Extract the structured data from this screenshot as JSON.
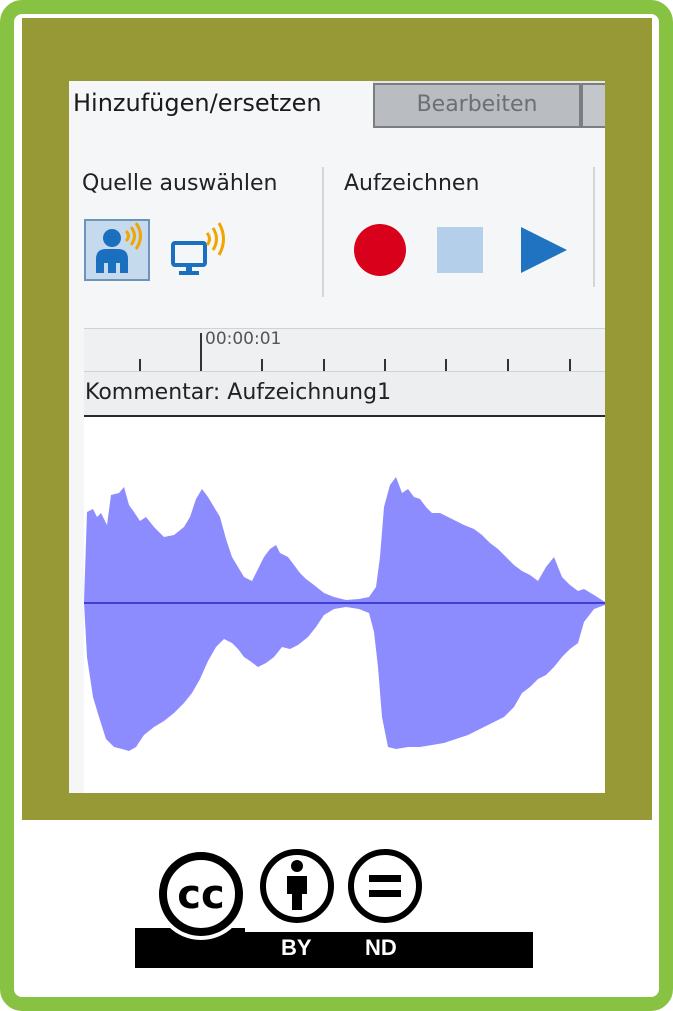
{
  "tabs": {
    "active": "Hinzufügen/ersetzen",
    "second": "Bearbeiten"
  },
  "ribbon": {
    "source_group_label": "Quelle auswählen",
    "record_group_label": "Aufzeichnen",
    "source_buttons": [
      {
        "icon": "microphone-person-icon",
        "selected": true
      },
      {
        "icon": "computer-audio-icon",
        "selected": false
      }
    ],
    "record_buttons": [
      {
        "icon": "record-icon",
        "color": "#d9001b"
      },
      {
        "icon": "stop-icon",
        "color": "#b3cfe9"
      },
      {
        "icon": "play-icon",
        "color": "#1f73c1"
      }
    ]
  },
  "timeline": {
    "time_marker": "00:00:01"
  },
  "track": {
    "label": "Kommentar: Aufzeichnung1",
    "wave_color": "#8c8cff",
    "center_line_color": "#3f3fd6"
  },
  "license": {
    "badge_text": [
      "BY",
      "ND"
    ],
    "icons": [
      "cc-icon",
      "attribution-person-icon",
      "no-derivatives-equals-icon"
    ]
  },
  "colors": {
    "frame_green": "#88c242",
    "olive_background": "#979836"
  }
}
